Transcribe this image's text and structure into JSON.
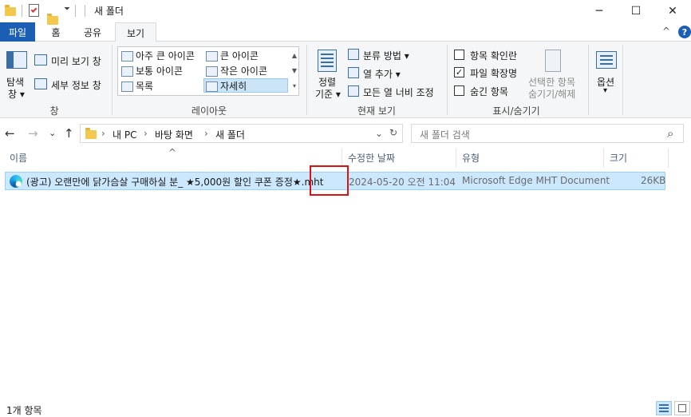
{
  "window": {
    "title": "새 폴더",
    "minimize": "─",
    "maximize": "☐",
    "close": "✕"
  },
  "ribbon_tabs": [
    "파일",
    "홈",
    "공유",
    "보기"
  ],
  "ribbon_collapse": "^",
  "help": "?",
  "ribbon": {
    "pane": {
      "nav_pane": "탐색\n창",
      "nav_pane_line1": "탐색",
      "nav_pane_line2": "창 ▾",
      "preview": "미리 보기 창",
      "details": "세부 정보 창",
      "label": "창"
    },
    "layout": {
      "items": [
        "아주 큰 아이콘",
        "큰 아이콘",
        "보통 아이콘",
        "작은 아이콘",
        "목록",
        "자세히"
      ],
      "selected": "자세히",
      "label": "레이아웃"
    },
    "current_view": {
      "sort_line1": "정렬",
      "sort_line2": "기준 ▾",
      "group_by": "분류 방법 ▾",
      "add_columns": "열 추가 ▾",
      "fit_columns": "모든 열 너비 조정",
      "label": "현재 보기"
    },
    "show_hide": {
      "item_checkboxes": "항목 확인란",
      "item_checkboxes_checked": false,
      "file_extensions": "파일 확장명",
      "file_extensions_checked": true,
      "hidden_items": "숨긴 항목",
      "hidden_items_checked": false,
      "hide_selected_line1": "선택한 항목",
      "hide_selected_line2": "숨기기/해제",
      "label": "표시/숨기기"
    },
    "options": {
      "label_line1": "옵션",
      "label_line2": "▾"
    }
  },
  "address": {
    "back": "←",
    "forward": "→",
    "recent": "⌄",
    "up": "↑",
    "crumbs": [
      "내 PC",
      "바탕 화면",
      "새 폴더"
    ],
    "separator": "›",
    "dropdown": "⌄",
    "refresh": "↻",
    "search_placeholder": "새 폴더 검색",
    "search_icon": "⌕"
  },
  "columns": {
    "name": "이름",
    "modified": "수정한 날짜",
    "type": "유형",
    "size": "크기",
    "sort_indicator": "^"
  },
  "files": [
    {
      "name": "(광고) 오랜만에 닭가슴살 구매하실 분_ ★5,000원 할인 쿠폰 증정★.mht",
      "modified": "2024-05-20 오전 11:04",
      "type": "Microsoft Edge MHT Document",
      "size": "26KB",
      "icon": "edge-icon"
    }
  ],
  "status": {
    "count": "1개 항목"
  },
  "colors": {
    "accent": "#1a5fb4",
    "selection": "#cce8ff",
    "highlight_box": "#e01010"
  }
}
